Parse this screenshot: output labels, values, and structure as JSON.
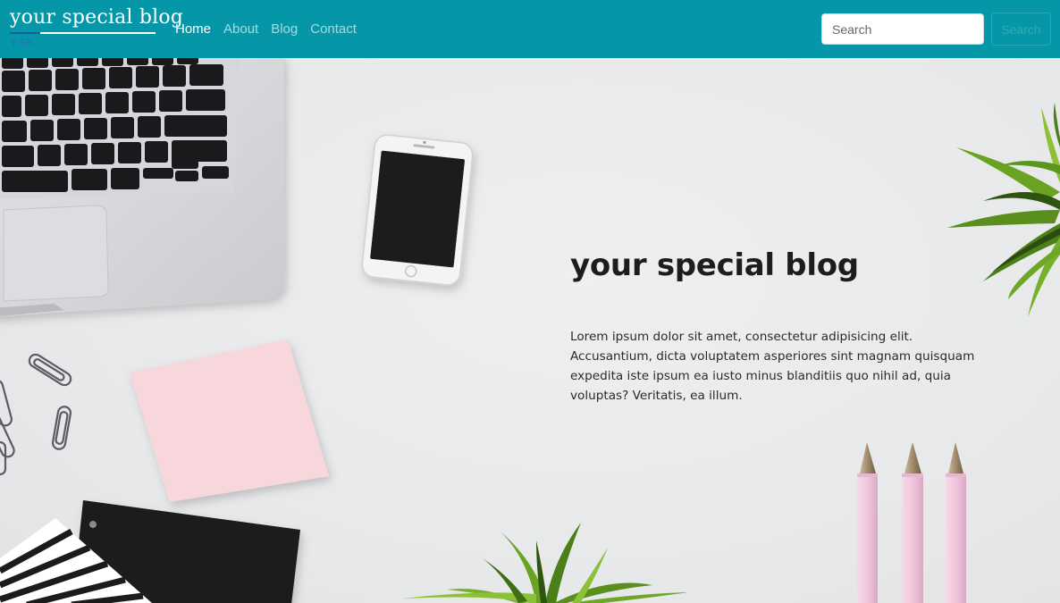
{
  "brand": {
    "title": "your special blog",
    "subtitle": "YSB"
  },
  "nav": {
    "items": [
      {
        "label": "Home",
        "active": true
      },
      {
        "label": "About",
        "active": false
      },
      {
        "label": "Blog",
        "active": false
      },
      {
        "label": "Contact",
        "active": false
      }
    ]
  },
  "search": {
    "placeholder": "Search",
    "button_label": "Search"
  },
  "hero": {
    "title": "your special blog",
    "text": "Lorem ipsum dolor sit amet, consectetur adipisicing elit. Accusantium, dicta voluptatem asperiores sint magnam quisquam expedita iste ipsum ea iusto minus blanditiis quo nihil ad, quia voluptas? Veritatis, ea illum."
  },
  "colors": {
    "navbar": "#0597a7",
    "background": "#e9eaeb",
    "sticky_note": "#f7d6dc",
    "pencil": "#f1c8dc"
  }
}
